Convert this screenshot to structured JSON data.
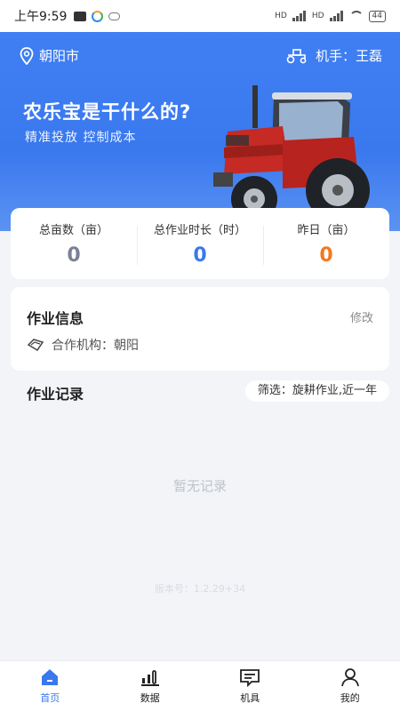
{
  "status_bar": {
    "time": "上午9:59",
    "battery": "44",
    "net_label_1": "HD",
    "net_label_2": "HD"
  },
  "header": {
    "location": "朝阳市",
    "operator": "机手：王磊"
  },
  "banner": {
    "headline": "农乐宝是干什么的?",
    "subline": "精准投放 控制成本"
  },
  "stats": [
    {
      "label": "总亩数（亩）",
      "value": "0",
      "color": "#7b8098"
    },
    {
      "label": "总作业时长（时）",
      "value": "0",
      "color": "#3a78ee"
    },
    {
      "label": "昨日（亩）",
      "value": "0",
      "color": "#f07a22"
    }
  ],
  "work_info": {
    "title": "作业信息",
    "edit": "修改",
    "org": "合作机构：朝阳"
  },
  "records": {
    "title": "作业记录",
    "filter": "筛选：旋耕作业,近一年",
    "empty": "暂无记录",
    "version": "版本号：1.2.29+34"
  },
  "tabs": [
    {
      "label": "首页",
      "icon": "home-icon"
    },
    {
      "label": "数据",
      "icon": "bar-chart-icon"
    },
    {
      "label": "机具",
      "icon": "message-icon"
    },
    {
      "label": "我的",
      "icon": "user-icon"
    }
  ],
  "colors": {
    "accent": "#3a78ee",
    "orange": "#f07a22"
  }
}
